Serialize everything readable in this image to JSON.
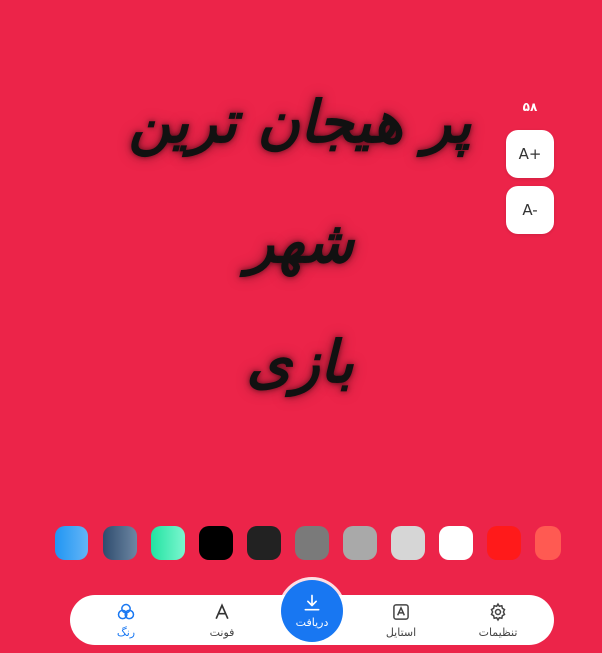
{
  "canvas": {
    "line1": "پر هیجان ترین شهر",
    "line2": "بازی",
    "text_color": "#111111",
    "background_color": "#ec2449"
  },
  "font_size": {
    "value": "۵۸",
    "increase_label": "A+",
    "decrease_label": "A-"
  },
  "swatches": [
    {
      "name": "swatch-blue-gradient",
      "color": "linear-gradient(90deg,#2196f3,#64b5f6)"
    },
    {
      "name": "swatch-slate-gradient",
      "color": "linear-gradient(90deg,#2f4c6e,#6d87a3)"
    },
    {
      "name": "swatch-mint-gradient",
      "color": "linear-gradient(90deg,#22e3a2,#7cf5cf)"
    },
    {
      "name": "swatch-black",
      "color": "#000000"
    },
    {
      "name": "swatch-charcoal",
      "color": "#222222"
    },
    {
      "name": "swatch-gray",
      "color": "#7a7a7a"
    },
    {
      "name": "swatch-silver",
      "color": "#a9a9a9"
    },
    {
      "name": "swatch-light-gray",
      "color": "#d6d6d6"
    },
    {
      "name": "swatch-white",
      "color": "#ffffff"
    },
    {
      "name": "swatch-red",
      "color": "#ff1a1a"
    },
    {
      "name": "swatch-coral",
      "color": "#ff5a52"
    }
  ],
  "nav": {
    "settings": "تنظیمات",
    "style": "استایل",
    "download": "دریافت",
    "font": "فونت",
    "color": "رنگ",
    "active": "color",
    "accent": "#1877f2"
  }
}
